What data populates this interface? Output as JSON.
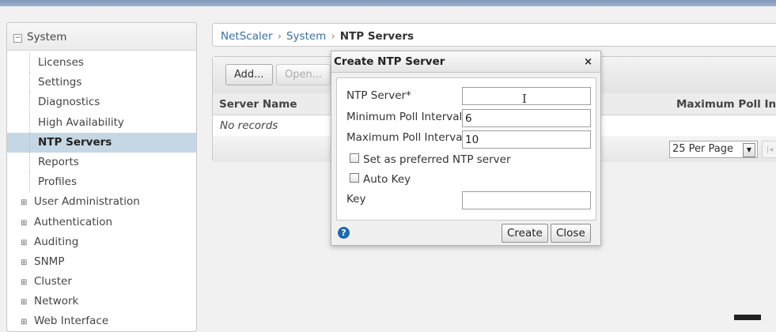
{
  "sidebar": {
    "header_label": "System",
    "items": [
      {
        "label": "Licenses",
        "type": "leaf"
      },
      {
        "label": "Settings",
        "type": "leaf"
      },
      {
        "label": "Diagnostics",
        "type": "leaf"
      },
      {
        "label": "High Availability",
        "type": "leaf"
      },
      {
        "label": "NTP Servers",
        "type": "leaf",
        "active": true
      },
      {
        "label": "Reports",
        "type": "leaf"
      },
      {
        "label": "Profiles",
        "type": "leaf"
      },
      {
        "label": "User Administration",
        "type": "group"
      },
      {
        "label": "Authentication",
        "type": "group"
      },
      {
        "label": "Auditing",
        "type": "group"
      },
      {
        "label": "SNMP",
        "type": "group"
      },
      {
        "label": "Cluster",
        "type": "group"
      },
      {
        "label": "Network",
        "type": "group"
      },
      {
        "label": "Web Interface",
        "type": "group"
      }
    ]
  },
  "breadcrumb": {
    "root": "NetScaler",
    "parent": "System",
    "current": "NTP Servers"
  },
  "panel": {
    "add_label": "Add...",
    "open_label": "Open...",
    "col_server_name": "Server Name",
    "col_max_poll": "Maximum Poll Inte",
    "empty_text": "No records",
    "per_page": "25 Per Page"
  },
  "dialog": {
    "title": "Create NTP Server",
    "close_glyph": "×",
    "ntp_server_label": "NTP Server*",
    "ntp_server_value": "",
    "min_poll_label": "Minimum Poll Interval",
    "min_poll_value": "6",
    "max_poll_label": "Maximum Poll Interval",
    "max_poll_value": "10",
    "preferred_label": "Set as preferred NTP server",
    "auto_key_label": "Auto Key",
    "key_label": "Key",
    "key_value": "",
    "help_glyph": "?",
    "create_label": "Create",
    "close_label": "Close"
  },
  "colors": {
    "link": "#3a6fa5",
    "active_row": "#c5d7e4",
    "help_icon": "#1d6ab0"
  }
}
